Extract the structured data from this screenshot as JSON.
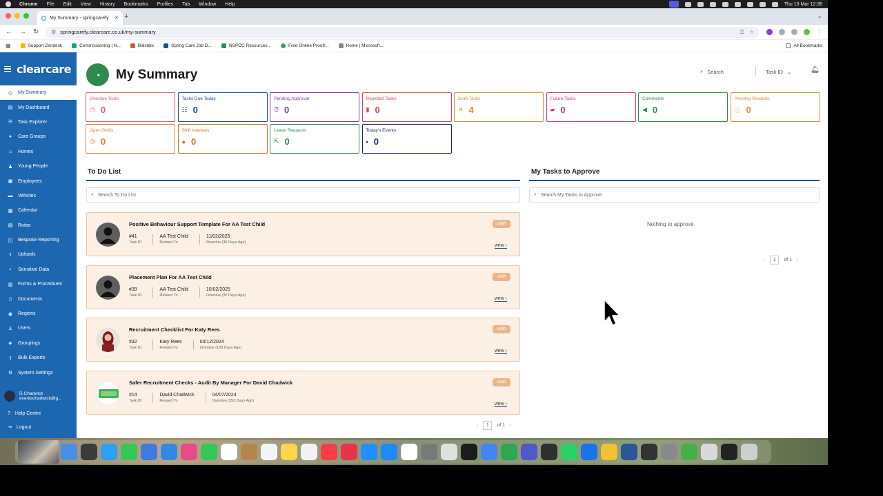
{
  "menubar": {
    "app": "Chrome",
    "items": [
      "File",
      "Edit",
      "View",
      "History",
      "Bookmarks",
      "Profiles",
      "Tab",
      "Window",
      "Help"
    ],
    "datetime": "Thu 13 Mar  12:36"
  },
  "browser": {
    "tab_title": "My Summary - springcarefy",
    "url": "springcarefy.clearcare.co.uk/my-summary",
    "bookmarks": [
      "Support Zendesk",
      "Commissioning | N...",
      "Bidstats",
      "Spring Care Job D...",
      "NSPCC Resources...",
      "Free Online Proofr...",
      "Home | Microsoft..."
    ],
    "all_bookmarks": "All Bookmarks"
  },
  "sidebar": {
    "logo": "clearcare",
    "items": [
      {
        "label": "My Summary",
        "icon": "clock-icon"
      },
      {
        "label": "My Dashboard",
        "icon": "dashboard-icon"
      },
      {
        "label": "Task Explorer",
        "icon": "tasks-icon"
      },
      {
        "label": "Care Groups",
        "icon": "group-icon"
      },
      {
        "label": "Homes",
        "icon": "home-icon"
      },
      {
        "label": "Young People",
        "icon": "person-icon"
      },
      {
        "label": "Employees",
        "icon": "id-icon"
      },
      {
        "label": "Vehicles",
        "icon": "car-icon"
      },
      {
        "label": "Calendar",
        "icon": "calendar-icon"
      },
      {
        "label": "Rotas",
        "icon": "rota-icon"
      },
      {
        "label": "Bespoke Reporting",
        "icon": "report-icon"
      },
      {
        "label": "Uploads",
        "icon": "upload-icon"
      },
      {
        "label": "Sensitive Data",
        "icon": "lock-icon"
      },
      {
        "label": "Forms & Procedures",
        "icon": "form-icon"
      },
      {
        "label": "Documents",
        "icon": "document-icon"
      },
      {
        "label": "Regions",
        "icon": "region-icon"
      },
      {
        "label": "Users",
        "icon": "user-icon"
      },
      {
        "label": "Groupings",
        "icon": "grouping-icon"
      },
      {
        "label": "Bulk Exports",
        "icon": "export-icon"
      },
      {
        "label": "System Settings",
        "icon": "gear-icon"
      }
    ],
    "user_name": "D.Chadwick",
    "user_email": "eventschadwick@g...",
    "help": "Help Centre",
    "logout": "Logout"
  },
  "header": {
    "title": "My Summary",
    "search_placeholder": "Search",
    "search_type": "Task ID"
  },
  "cards": [
    {
      "label": "Overdue Tasks",
      "value": "0",
      "color": "#d6616b"
    },
    {
      "label": "Tasks Due Today",
      "value": "0",
      "color": "#1d4f86"
    },
    {
      "label": "Pending Approval",
      "value": "0",
      "color": "#7b3aa5"
    },
    {
      "label": "Rejected Tasks",
      "value": "0",
      "color": "#d6455a"
    },
    {
      "label": "Draft Tasks",
      "value": "4",
      "color": "#e08a3c"
    },
    {
      "label": "Future Tasks",
      "value": "0",
      "color": "#d63384"
    },
    {
      "label": "Comments",
      "value": "0",
      "color": "#2e8a4e"
    },
    {
      "label": "Pending Rewards",
      "value": "0",
      "color": "#e08a3c"
    },
    {
      "label": "Open Shifts",
      "value": "0",
      "color": "#d9813a"
    },
    {
      "label": "Shift Interests",
      "value": "0",
      "color": "#c8742a"
    },
    {
      "label": "Leave Requests",
      "value": "0",
      "color": "#2e8a4e"
    },
    {
      "label": "Today's Events",
      "value": "0",
      "color": "#1a2b56"
    }
  ],
  "todo": {
    "title": "To Do List",
    "search_placeholder": "Search To Do List",
    "tasks": [
      {
        "title": "Positive Behaviour Support Template For AA Test Child",
        "status": "draft",
        "id": "#41",
        "id_label": "Task ID",
        "related": "AA Test Child",
        "related_label": "Related To",
        "date": "11/02/2025",
        "overdue": "Overdue (30 Days Ago)",
        "view": "view"
      },
      {
        "title": "Placement Plan For AA Test Child",
        "status": "draft",
        "id": "#39",
        "id_label": "Task ID",
        "related": "AA Test Child",
        "related_label": "Related To",
        "date": "10/02/2025",
        "overdue": "Overdue (30 Days Ago)",
        "view": "view"
      },
      {
        "title": "Recruitment Checklist For Katy Rees",
        "status": "draft",
        "id": "#32",
        "id_label": "Task ID",
        "related": "Katy Rees",
        "related_label": "Related To",
        "date": "03/12/2024",
        "overdue": "Overdue (100 Days Ago)",
        "view": "view"
      },
      {
        "title": "Safer Recruitment Checks - Audit By Manager For David Chadwick",
        "status": "draft",
        "id": "#14",
        "id_label": "Task ID",
        "related": "David Chadwick",
        "related_label": "Related To",
        "date": "04/07/2024",
        "overdue": "Overdue (252 Days Ago)",
        "view": "view"
      }
    ],
    "page": "1",
    "of": "of 1"
  },
  "approve": {
    "title": "My Tasks to Approve",
    "search_placeholder": "Search My Tasks to Approve",
    "empty": "Nothing to approve",
    "page": "1",
    "of": "of 1"
  }
}
